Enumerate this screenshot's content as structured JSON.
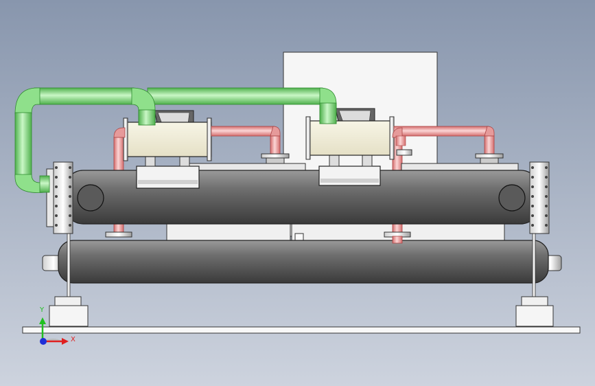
{
  "viewport": {
    "background_top": "#8896ad",
    "background_bottom": "#cdd3de"
  },
  "model": {
    "pipe_colors": {
      "green_pipe": "#7ee07a",
      "red_pipe": "#f0a0a0",
      "shell": "#707070",
      "panel": "#f4f4f4"
    }
  },
  "triad": {
    "x_label": "X",
    "y_label": "Y",
    "x_color": "#e02020",
    "y_color": "#20c020",
    "z_color": "#1f2fd8"
  }
}
